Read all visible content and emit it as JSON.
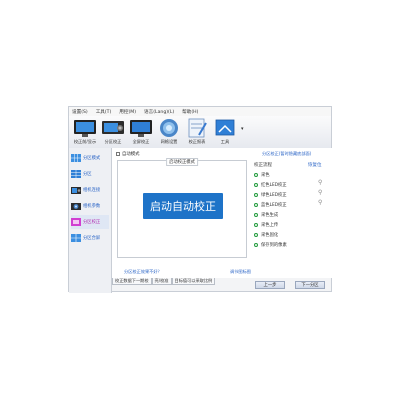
{
  "menubar": [
    "设置(S)",
    "工具(T)",
    "用控(M)",
    "语言(Lang)(L)",
    "帮助(H)"
  ],
  "toolbar": [
    {
      "label": "校正前/显示",
      "icon": "monitor-icon"
    },
    {
      "label": "分区校正",
      "icon": "camera-icon"
    },
    {
      "label": "全屏校正",
      "icon": "screen-icon"
    },
    {
      "label": "网格设置",
      "icon": "disc-icon"
    },
    {
      "label": "校正报表",
      "icon": "report-icon"
    },
    {
      "label": "工具",
      "icon": "tools-icon"
    }
  ],
  "sidebar": [
    {
      "label": "分区模式",
      "icon": "grid-icon"
    },
    {
      "label": "分区",
      "icon": "partition-icon"
    },
    {
      "label": "相机连接",
      "icon": "camera-icon"
    },
    {
      "label": "相机参数",
      "icon": "camera-settings-icon"
    },
    {
      "label": "分区校正",
      "icon": "calibrate-icon"
    },
    {
      "label": "分区合屏",
      "icon": "merge-icon"
    }
  ],
  "main": {
    "checkbox_label": "自动模式",
    "group_title": "启动校正模式",
    "start_button": "启动自动校正",
    "left_link": "分区校正效果不好？",
    "right_link": "调节图标图",
    "right_header": "分区校正(暂时隐藏底部面)",
    "steps_title": "校正流程",
    "restore": "恢复位",
    "steps": [
      "采色",
      "红色LED校正",
      "绿色LED校正",
      "蓝色LED校正",
      "采色生成",
      "采色上传",
      "采色固化",
      "保存到的像素"
    ]
  },
  "tabs": [
    "校正数据下一期校",
    "亮/校准",
    "目标值可以采取比例"
  ],
  "buttons": {
    "prev": "上一步",
    "next": "下一分区"
  }
}
